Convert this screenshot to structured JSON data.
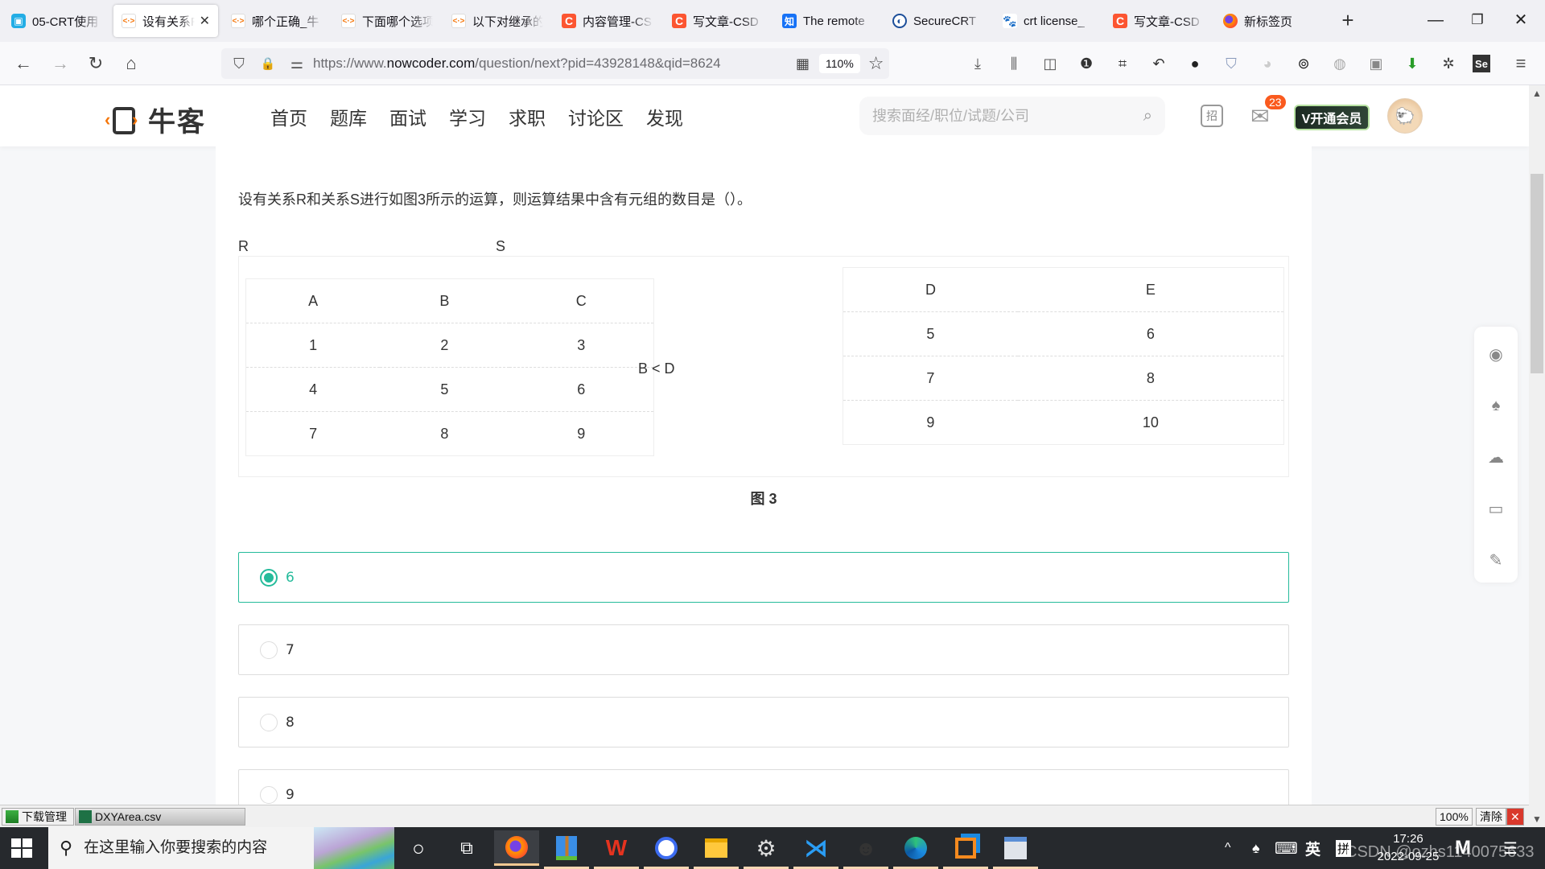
{
  "browser": {
    "tabs": [
      {
        "label": "05-CRT使用",
        "icon": "bilibili-icon",
        "active": false
      },
      {
        "label": "设有关系R",
        "icon": "nowcoder-icon",
        "active": true
      },
      {
        "label": "哪个正确_牛",
        "icon": "nowcoder-icon",
        "active": false
      },
      {
        "label": "下面哪个选项",
        "icon": "nowcoder-icon",
        "active": false
      },
      {
        "label": "以下对继承的",
        "icon": "nowcoder-icon",
        "active": false
      },
      {
        "label": "内容管理-CS",
        "icon": "csdn-icon",
        "active": false
      },
      {
        "label": "写文章-CSD",
        "icon": "csdn-icon",
        "active": false
      },
      {
        "label": "The remote",
        "icon": "zhihu-icon",
        "active": false
      },
      {
        "label": "SecureCRT",
        "icon": "securecrt-icon",
        "active": false
      },
      {
        "label": "crt license_",
        "icon": "baidu-icon",
        "active": false
      },
      {
        "label": "写文章-CSD",
        "icon": "csdn-icon",
        "active": false
      },
      {
        "label": "新标签页",
        "icon": "firefox-icon",
        "active": false
      }
    ],
    "tab_icon_glyphs": {
      "nowcoder": "<·>",
      "bilibili": "▣",
      "csdn": "C",
      "zhihu": "知",
      "securecrt": "◐",
      "baidu": "🐾",
      "firefox": ""
    },
    "close_glyph": "✕",
    "new_tab_glyph": "+",
    "window_controls": {
      "minimize": "—",
      "restore": "❐",
      "close": "✕"
    },
    "nav": {
      "back": "←",
      "forward": "→",
      "reload": "↻",
      "home": "⌂"
    },
    "url": {
      "prefix": "https://www.",
      "domain": "nowcoder.com",
      "path": "/question/next?pid=43928148&qid=8624"
    },
    "zoom_level": "110%",
    "url_icons": {
      "shield": "⛉",
      "lock": "🔒",
      "permissions": "⚌",
      "qr": "▦",
      "star": "☆"
    },
    "toolbar_icons": [
      "⤓",
      "⫼",
      "◫",
      "❶",
      "⌗",
      "↶",
      "●",
      "⛉",
      "◕",
      "⊚",
      "◍",
      "▣",
      "⬇",
      "✲",
      "Se",
      "≡"
    ]
  },
  "site": {
    "logo_text": "牛客",
    "nav": [
      "首页",
      "题库",
      "面试",
      "学习",
      "求职",
      "讨论区",
      "发现"
    ],
    "search_placeholder": "搜索面经/职位/试题/公司",
    "search_glyph": "⌕",
    "recruit_glyph": "招",
    "mail_glyph": "✉",
    "mail_badge": "23",
    "vip_label": "V开通会员",
    "avatar_glyph": "🐑"
  },
  "question": {
    "text": "设有关系R和关系S进行如图3所示的运算，则运算结果中含有元组的数目是（）。",
    "relation_r_label": "R",
    "relation_s_label": "S",
    "relation_r": {
      "headers": [
        "A",
        "B",
        "C"
      ],
      "rows": [
        [
          "1",
          "2",
          "3"
        ],
        [
          "4",
          "5",
          "6"
        ],
        [
          "7",
          "8",
          "9"
        ]
      ]
    },
    "operator": "B < D",
    "relation_s": {
      "headers": [
        "D",
        "E"
      ],
      "rows": [
        [
          "5",
          "6"
        ],
        [
          "7",
          "8"
        ],
        [
          "9",
          "10"
        ]
      ]
    },
    "figure_caption": "图 3",
    "options": [
      {
        "label": "6",
        "selected": true
      },
      {
        "label": "7",
        "selected": false
      },
      {
        "label": "8",
        "selected": false
      },
      {
        "label": "9",
        "selected": false
      }
    ],
    "accent_color": "#25bb9b"
  },
  "share_panel": [
    "weibo-icon",
    "qq-icon",
    "wechat-icon",
    "tablet-icon",
    "edit-icon"
  ],
  "share_glyphs": [
    "◉",
    "♠",
    "☁",
    "▭",
    "✎"
  ],
  "download_bar": {
    "manager_label": "下载管理",
    "file_label": "DXYArea.csv",
    "zoom_label": "100%",
    "clear_label": "清除",
    "close_glyph": "✕"
  },
  "taskbar": {
    "search_placeholder": "在这里输入你要搜索的内容",
    "time": "17:26",
    "date": "2022-09-25",
    "ime_lang": "英",
    "ime_mode": "拼",
    "tray_up": "^",
    "watermark": "CSDN @ozhs1140075633"
  }
}
